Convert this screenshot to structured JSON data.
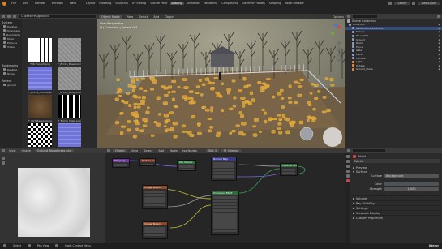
{
  "app": {
    "menu": [
      "File",
      "Edit",
      "Render",
      "Window",
      "Help"
    ],
    "workspace_tabs": [
      "Layout",
      "Modeling",
      "Sculpting",
      "UV Editing",
      "Texture Paint",
      "Shading",
      "Animation",
      "Rendering",
      "Compositing",
      "Geometry Nodes",
      "Scripting",
      "Asset Browser"
    ],
    "active_tab": "Shading",
    "scene_label": "Scene",
    "view_layer_label": "ViewLayer"
  },
  "file_browser": {
    "path": "C:\\textures\\ground\\",
    "sidebar_sections": [
      "System",
      "Bookmarks",
      "Recent"
    ],
    "system_items": [
      "Desktop",
      "Downloads",
      "Documents",
      "Music",
      "Pictures",
      "Videos"
    ],
    "bookmark_items": [
      "Desktop",
      "Home"
    ],
    "recent_items": [
      "ground"
    ],
    "files": [
      {
        "name": "T_Bricks_AO.png",
        "kind": "ao"
      },
      {
        "name": "T_Bricks_BaseColor.png",
        "kind": "grey"
      },
      {
        "name": "T_Bricks_Normal.png",
        "kind": "normal"
      },
      {
        "name": "T_Bricks_Roughness.png",
        "kind": "grey"
      },
      {
        "name": "T_Dirt_BaseColor.png",
        "kind": "dirt"
      },
      {
        "name": "T_Bricks_Mask.png",
        "kind": "mask"
      },
      {
        "name": "T_Dirt_Rough.png",
        "kind": "pattern"
      },
      {
        "name": "T_Dirt_Normal.png",
        "kind": "normal"
      }
    ]
  },
  "viewport": {
    "mode": "Object Mode",
    "menu": [
      "View",
      "Select",
      "Add",
      "Object"
    ],
    "overlay_title": "User Perspective",
    "overlay_subtitle": "(1) Collection | Sphere.001",
    "options_label": "Options"
  },
  "outliner": {
    "title": "Scene Collection",
    "items": [
      "Collection",
      "Background_Structure",
      "Foliage",
      "Trees_001",
      "Ground",
      "Rocks",
      "Fence",
      "Gate",
      "Plants",
      "Camera",
      "Light",
      "Sphere",
      "Ground_Plane"
    ]
  },
  "image_editor": {
    "view_menu": [
      "View",
      "Image"
    ],
    "image_name": "Ground_Roughness.png"
  },
  "node_editor": {
    "mode": "Object",
    "menu": [
      "View",
      "Select",
      "Add",
      "Node"
    ],
    "use_nodes_label": "Use Nodes",
    "slot_label": "Slot 1",
    "material_label": "M_Ground",
    "nodes": [
      {
        "title": "Mapping",
        "color": "#6b3b9c"
      },
      {
        "title": "Texture Coordinate",
        "color": "#7a3b2a"
      },
      {
        "title": "Image Texture",
        "color": "#8a4a2a"
      },
      {
        "title": "Image Texture",
        "color": "#8a4a2a"
      },
      {
        "title": "Principled BSDF",
        "color": "#2f6b3a"
      },
      {
        "title": "Material Output",
        "color": "#2f6b3a"
      },
      {
        "title": "Normal Map",
        "color": "#3a3a8a"
      },
      {
        "title": "Mix Shader",
        "color": "#2f6b3a"
      }
    ]
  },
  "properties": {
    "world_name": "World",
    "tab_label": "World",
    "sections": [
      "Preview",
      "Surface"
    ],
    "surface_label": "Surface",
    "surface_value": "Background",
    "color_label": "Color",
    "strength_label": "Strength",
    "strength_value": "1.000",
    "more_sections": [
      "Volume",
      "Ray Visibility",
      "Settings",
      "Viewport Display",
      "Custom Properties"
    ]
  },
  "status": {
    "left": [
      "Select",
      "Pan View",
      "Node Context Menu"
    ],
    "right": "Udemy"
  }
}
